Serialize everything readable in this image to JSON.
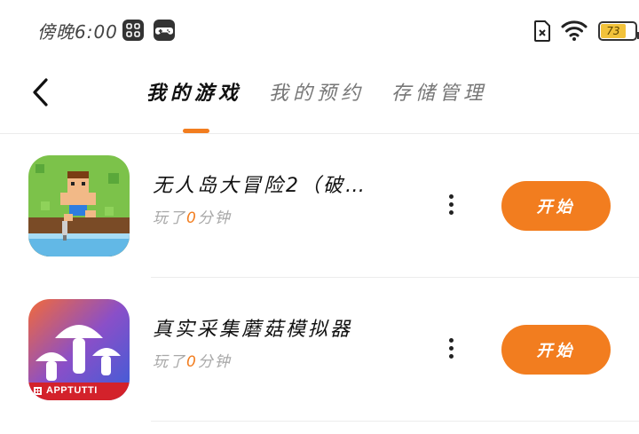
{
  "status_bar": {
    "time": "傍晚6:00",
    "battery_level": "73",
    "icons": [
      "grid-app-icon",
      "gamepad-icon",
      "sim-icon",
      "wifi-icon",
      "battery-icon"
    ]
  },
  "header": {
    "back_icon": "chevron-left-icon",
    "tabs": [
      {
        "label": "我的游戏",
        "active": true
      },
      {
        "label": "我的预约",
        "active": false
      },
      {
        "label": "存储管理",
        "active": false
      }
    ]
  },
  "games": [
    {
      "name": "无人岛大冒险2（破…",
      "play_prefix": "玩了",
      "play_hours": "0",
      "play_suffix": "分钟",
      "start_label": "开始",
      "icon": "pixel-island-game-icon"
    },
    {
      "name": "真实采集蘑菇模拟器",
      "play_prefix": "玩了",
      "play_hours": "0",
      "play_suffix": "分钟",
      "start_label": "开始",
      "icon": "mushroom-game-icon",
      "icon_badge": "APPTUTTI"
    }
  ],
  "colors": {
    "accent": "#f27d1f",
    "text": "#111111",
    "muted": "#a8a8a8",
    "divider": "#ececec",
    "battery": "#f2c23a"
  }
}
